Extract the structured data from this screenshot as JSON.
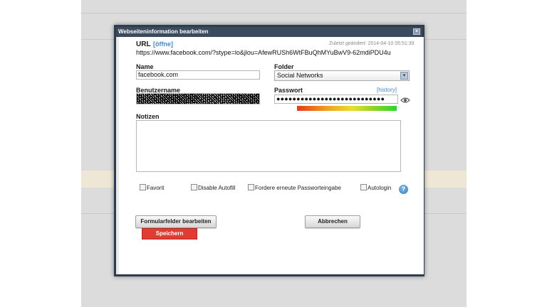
{
  "dialog": {
    "title": "Webseiteninformation bearbeiten",
    "close_glyph": "×"
  },
  "url": {
    "label": "URL",
    "open_link": "[öffne]",
    "last_modified": "Zuletzt geändert: 2014-04-10 05:51:39",
    "value": "https://www.facebook.com/?stype=lo&jlou=AfewRUSh6WtFBuQhMYuBwV9-62mdiPDU4u"
  },
  "name": {
    "label": "Name",
    "value": "facebook.com"
  },
  "folder": {
    "label": "Folder",
    "selected": "Social Networks",
    "arrow_glyph": "▾"
  },
  "username": {
    "label": "Benutzername"
  },
  "password": {
    "label": "Passwort",
    "history_link": "[history]",
    "masked_value": "●●●●●●●●●●●●●●●●●●●●●●●●●●●",
    "strength_level": 1.0,
    "show_icon": "eye-icon"
  },
  "notes": {
    "label": "Notizen",
    "value": ""
  },
  "options": [
    {
      "label": "Favorit",
      "checked": false
    },
    {
      "label": "Disable Autofill",
      "checked": false
    },
    {
      "label": "Fordere erneute Passworteingabe",
      "checked": false
    },
    {
      "label": "Autologin",
      "checked": false
    }
  ],
  "help": {
    "glyph": "?"
  },
  "buttons": {
    "form_fields": "Formularfelder bearbeiten",
    "cancel": "Abbrechen",
    "save": "Speichern"
  },
  "colors": {
    "title_bar": "#3a4b5e",
    "save_button": "#e13c34",
    "link": "#4a86c4"
  }
}
